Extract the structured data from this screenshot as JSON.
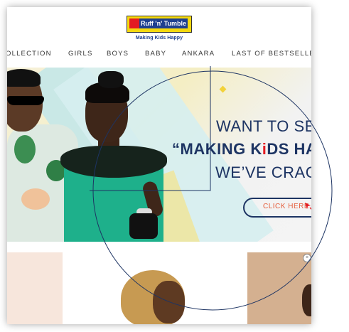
{
  "header": {
    "logo_text": "Ruff 'n' Tumble",
    "tagline": "Making Kids Happy"
  },
  "nav": {
    "items": [
      {
        "label": "OLLECTION"
      },
      {
        "label": "GIRLS"
      },
      {
        "label": "BOYS"
      },
      {
        "label": "BABY"
      },
      {
        "label": "ANKARA"
      },
      {
        "label": "LAST OF BESTSELLERS"
      }
    ]
  },
  "hero": {
    "line1": "WANT TO SE",
    "line2_open": "“MAKING K",
    "line2_red": "i",
    "line2_close": "DS HA",
    "line3": "WE’VE CRAC",
    "cta_label": "CLICK HERE"
  },
  "ad": {
    "close_glyph": "×"
  },
  "colors": {
    "brand_navy": "#1d3463",
    "brand_yellow": "#f5d90e",
    "brand_red": "#e31b23",
    "cta_text": "#e55c3a"
  }
}
